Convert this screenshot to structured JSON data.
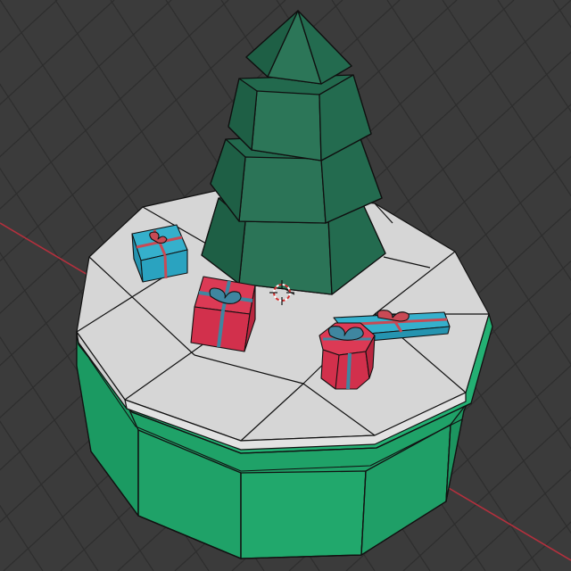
{
  "viewport": {
    "mode": "edit-mode-wireframe-overlay",
    "background_color": "#3b3b3b",
    "grid_color": "#2e2e2e",
    "x_axis_color": "#b3303d",
    "edge_color": "#111111"
  },
  "scene": {
    "tree": {
      "color_light": "#2c7458",
      "color_mid": "#226a4e",
      "color_dark": "#1b5a41",
      "tiers": 4
    },
    "platform_top": {
      "color": "#d4d4d4"
    },
    "base": {
      "color": "#1fa268",
      "color_dark": "#188754"
    },
    "gifts": [
      {
        "name": "blue-gift-back-left",
        "box_color": "#2aa3c0",
        "ribbon_color": "#c84a55"
      },
      {
        "name": "red-gift-center",
        "box_color": "#d2304c",
        "ribbon_color": "#3f86a0"
      },
      {
        "name": "blue-gift-flat-right",
        "box_color": "#2aa3c0",
        "ribbon_color": "#c84a55"
      },
      {
        "name": "red-gift-octagonal",
        "box_color": "#d2304c",
        "ribbon_color": "#3f86a0"
      }
    ]
  }
}
